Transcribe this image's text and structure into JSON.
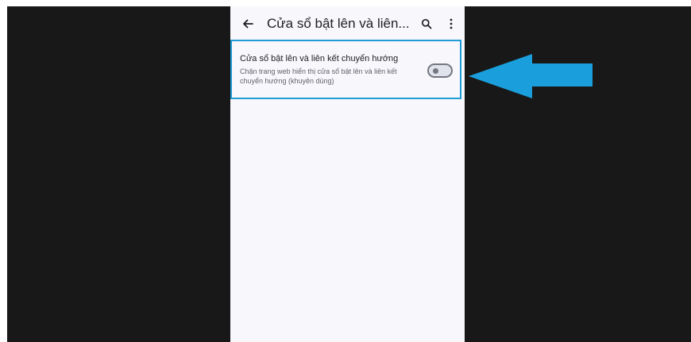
{
  "appbar": {
    "title": "Cửa sổ bật lên và liên...",
    "back_icon": "arrow-left-icon",
    "search_icon": "search-icon",
    "more_icon": "more-vert-icon"
  },
  "setting": {
    "title": "Cửa sổ bật lên và liên kết chuyển hướng",
    "summary": "Chặn trang web hiển thị cửa sổ bật lên và liên kết chuyển hướng (khuyên dùng)",
    "toggle_on": false
  },
  "annotation": {
    "arrow_color": "#1a9fdc",
    "highlight_color": "#1f9bd7"
  }
}
